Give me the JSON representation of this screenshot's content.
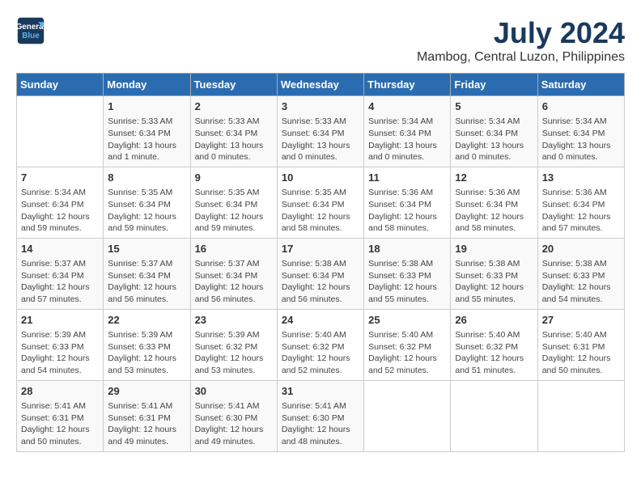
{
  "header": {
    "logo_line1": "General",
    "logo_line2": "Blue",
    "month_year": "July 2024",
    "location": "Mambog, Central Luzon, Philippines"
  },
  "days_of_week": [
    "Sunday",
    "Monday",
    "Tuesday",
    "Wednesday",
    "Thursday",
    "Friday",
    "Saturday"
  ],
  "weeks": [
    [
      {
        "day": "",
        "detail": ""
      },
      {
        "day": "1",
        "detail": "Sunrise: 5:33 AM\nSunset: 6:34 PM\nDaylight: 13 hours\nand 1 minute."
      },
      {
        "day": "2",
        "detail": "Sunrise: 5:33 AM\nSunset: 6:34 PM\nDaylight: 13 hours\nand 0 minutes."
      },
      {
        "day": "3",
        "detail": "Sunrise: 5:33 AM\nSunset: 6:34 PM\nDaylight: 13 hours\nand 0 minutes."
      },
      {
        "day": "4",
        "detail": "Sunrise: 5:34 AM\nSunset: 6:34 PM\nDaylight: 13 hours\nand 0 minutes."
      },
      {
        "day": "5",
        "detail": "Sunrise: 5:34 AM\nSunset: 6:34 PM\nDaylight: 13 hours\nand 0 minutes."
      },
      {
        "day": "6",
        "detail": "Sunrise: 5:34 AM\nSunset: 6:34 PM\nDaylight: 13 hours\nand 0 minutes."
      }
    ],
    [
      {
        "day": "7",
        "detail": "Sunrise: 5:34 AM\nSunset: 6:34 PM\nDaylight: 12 hours\nand 59 minutes."
      },
      {
        "day": "8",
        "detail": "Sunrise: 5:35 AM\nSunset: 6:34 PM\nDaylight: 12 hours\nand 59 minutes."
      },
      {
        "day": "9",
        "detail": "Sunrise: 5:35 AM\nSunset: 6:34 PM\nDaylight: 12 hours\nand 59 minutes."
      },
      {
        "day": "10",
        "detail": "Sunrise: 5:35 AM\nSunset: 6:34 PM\nDaylight: 12 hours\nand 58 minutes."
      },
      {
        "day": "11",
        "detail": "Sunrise: 5:36 AM\nSunset: 6:34 PM\nDaylight: 12 hours\nand 58 minutes."
      },
      {
        "day": "12",
        "detail": "Sunrise: 5:36 AM\nSunset: 6:34 PM\nDaylight: 12 hours\nand 58 minutes."
      },
      {
        "day": "13",
        "detail": "Sunrise: 5:36 AM\nSunset: 6:34 PM\nDaylight: 12 hours\nand 57 minutes."
      }
    ],
    [
      {
        "day": "14",
        "detail": "Sunrise: 5:37 AM\nSunset: 6:34 PM\nDaylight: 12 hours\nand 57 minutes."
      },
      {
        "day": "15",
        "detail": "Sunrise: 5:37 AM\nSunset: 6:34 PM\nDaylight: 12 hours\nand 56 minutes."
      },
      {
        "day": "16",
        "detail": "Sunrise: 5:37 AM\nSunset: 6:34 PM\nDaylight: 12 hours\nand 56 minutes."
      },
      {
        "day": "17",
        "detail": "Sunrise: 5:38 AM\nSunset: 6:34 PM\nDaylight: 12 hours\nand 56 minutes."
      },
      {
        "day": "18",
        "detail": "Sunrise: 5:38 AM\nSunset: 6:33 PM\nDaylight: 12 hours\nand 55 minutes."
      },
      {
        "day": "19",
        "detail": "Sunrise: 5:38 AM\nSunset: 6:33 PM\nDaylight: 12 hours\nand 55 minutes."
      },
      {
        "day": "20",
        "detail": "Sunrise: 5:38 AM\nSunset: 6:33 PM\nDaylight: 12 hours\nand 54 minutes."
      }
    ],
    [
      {
        "day": "21",
        "detail": "Sunrise: 5:39 AM\nSunset: 6:33 PM\nDaylight: 12 hours\nand 54 minutes."
      },
      {
        "day": "22",
        "detail": "Sunrise: 5:39 AM\nSunset: 6:33 PM\nDaylight: 12 hours\nand 53 minutes."
      },
      {
        "day": "23",
        "detail": "Sunrise: 5:39 AM\nSunset: 6:32 PM\nDaylight: 12 hours\nand 53 minutes."
      },
      {
        "day": "24",
        "detail": "Sunrise: 5:40 AM\nSunset: 6:32 PM\nDaylight: 12 hours\nand 52 minutes."
      },
      {
        "day": "25",
        "detail": "Sunrise: 5:40 AM\nSunset: 6:32 PM\nDaylight: 12 hours\nand 52 minutes."
      },
      {
        "day": "26",
        "detail": "Sunrise: 5:40 AM\nSunset: 6:32 PM\nDaylight: 12 hours\nand 51 minutes."
      },
      {
        "day": "27",
        "detail": "Sunrise: 5:40 AM\nSunset: 6:31 PM\nDaylight: 12 hours\nand 50 minutes."
      }
    ],
    [
      {
        "day": "28",
        "detail": "Sunrise: 5:41 AM\nSunset: 6:31 PM\nDaylight: 12 hours\nand 50 minutes."
      },
      {
        "day": "29",
        "detail": "Sunrise: 5:41 AM\nSunset: 6:31 PM\nDaylight: 12 hours\nand 49 minutes."
      },
      {
        "day": "30",
        "detail": "Sunrise: 5:41 AM\nSunset: 6:30 PM\nDaylight: 12 hours\nand 49 minutes."
      },
      {
        "day": "31",
        "detail": "Sunrise: 5:41 AM\nSunset: 6:30 PM\nDaylight: 12 hours\nand 48 minutes."
      },
      {
        "day": "",
        "detail": ""
      },
      {
        "day": "",
        "detail": ""
      },
      {
        "day": "",
        "detail": ""
      }
    ]
  ]
}
